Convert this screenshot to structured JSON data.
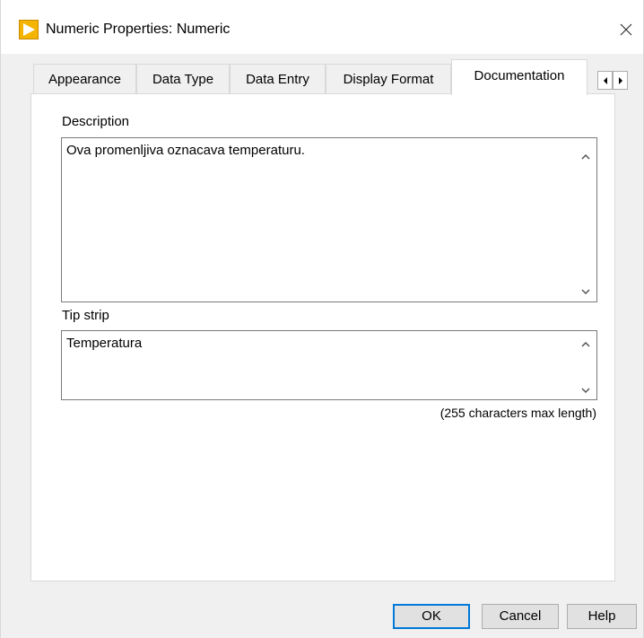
{
  "window": {
    "title": "Numeric Properties: Numeric",
    "close_label": "×"
  },
  "tabs": [
    {
      "label": "Appearance",
      "active": false
    },
    {
      "label": "Data Type",
      "active": false
    },
    {
      "label": "Data Entry",
      "active": false
    },
    {
      "label": "Display Format",
      "active": false
    },
    {
      "label": "Documentation",
      "active": true
    }
  ],
  "tab_scroll": {
    "left_icon": "triangle-left-icon",
    "right_icon": "triangle-right-icon"
  },
  "documentation": {
    "description_label": "Description",
    "description_value": "Ova promenljiva oznacava temperaturu.",
    "tip_strip_label": "Tip strip",
    "tip_strip_value": "Temperatura",
    "max_length_hint": "(255 characters max length)"
  },
  "buttons": {
    "ok": "OK",
    "cancel": "Cancel",
    "help": "Help"
  },
  "colors": {
    "app_icon": "#f4b400",
    "default_button_border": "#0078d7",
    "button_face": "#e1e1e1",
    "dialog_background": "#f0f0f0"
  }
}
